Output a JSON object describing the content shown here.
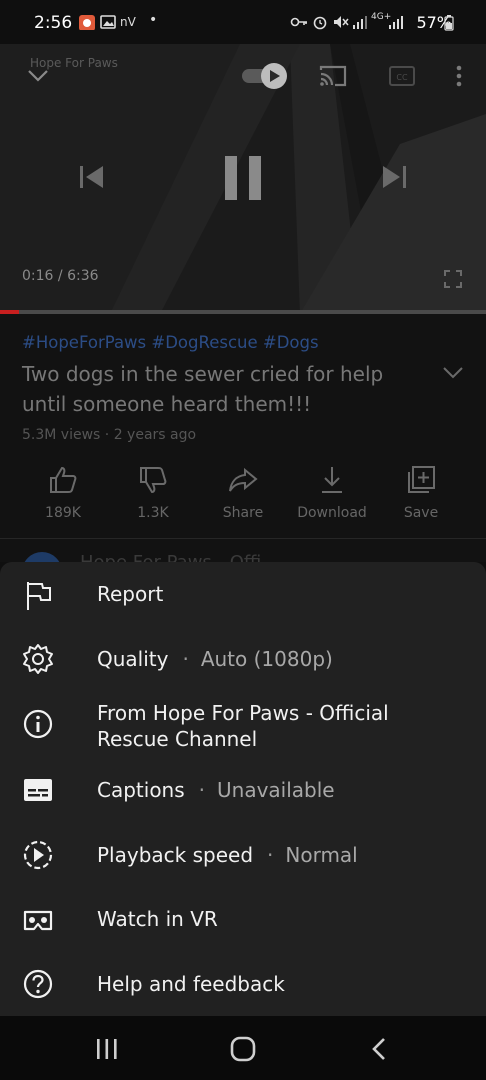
{
  "status_bar": {
    "time": "2:56",
    "battery": "57%",
    "network": "4G+"
  },
  "player": {
    "overlay_text": "Hope For Paws",
    "current_time": "0:16",
    "duration": "6:36",
    "time_separator": " / ",
    "progress_fraction": 0.04
  },
  "video": {
    "hashtags": "#HopeForPaws #DogRescue #Dogs",
    "title": "Two dogs in the sewer cried for help until someone heard them!!!",
    "views": "5.3M views",
    "age": "2 years ago",
    "meta_sep": " · "
  },
  "actions": [
    {
      "label": "189K",
      "icon": "thumbs-up-icon"
    },
    {
      "label": "1.3K",
      "icon": "thumbs-down-icon"
    },
    {
      "label": "Share",
      "icon": "share-icon"
    },
    {
      "label": "Download",
      "icon": "download-icon"
    },
    {
      "label": "Save",
      "icon": "save-playlist-icon"
    }
  ],
  "channel_peek": "Hope For Paws - Offi",
  "menu": [
    {
      "label": "Report",
      "value": "",
      "icon": "flag-icon"
    },
    {
      "label": "Quality",
      "value": "Auto (1080p)",
      "icon": "gear-icon"
    },
    {
      "label": "From Hope For Paws - Official\nRescue Channel",
      "value": "",
      "icon": "info-icon"
    },
    {
      "label": "Captions",
      "value": "Unavailable",
      "icon": "captions-icon"
    },
    {
      "label": "Playback speed",
      "value": "Normal",
      "icon": "playback-speed-icon"
    },
    {
      "label": "Watch in VR",
      "value": "",
      "icon": "vr-icon"
    },
    {
      "label": "Help and feedback",
      "value": "",
      "icon": "help-icon"
    }
  ],
  "menu_value_sep": "·"
}
